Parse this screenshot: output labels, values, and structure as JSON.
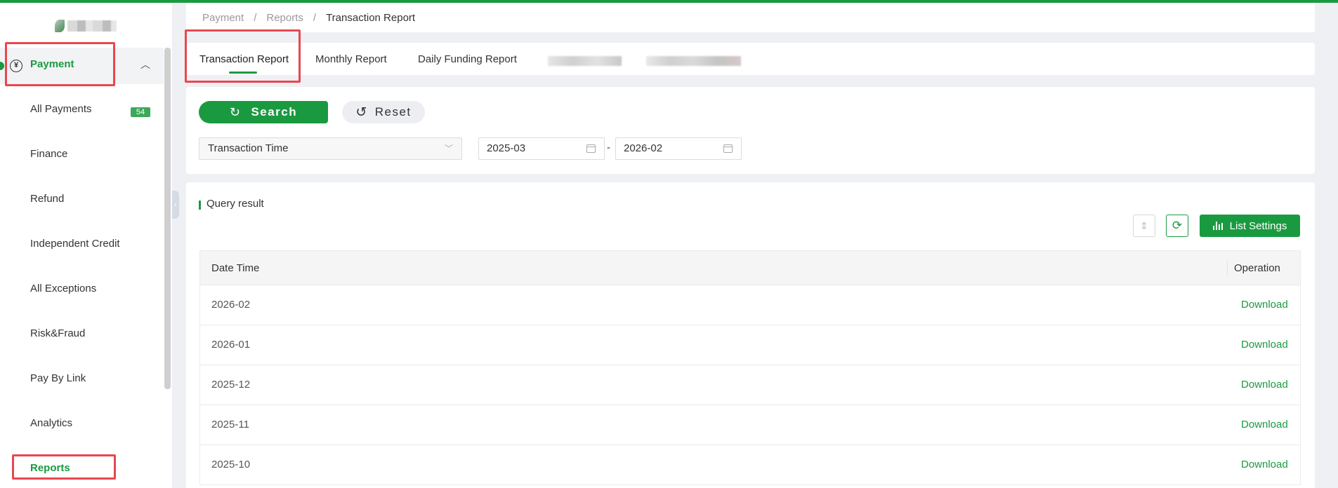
{
  "breadcrumb": {
    "items": [
      "Payment",
      "Reports"
    ],
    "current": "Transaction Report"
  },
  "sidebar": {
    "parent_label": "Payment",
    "payments_badge": "54",
    "items": [
      {
        "label": "All Payments"
      },
      {
        "label": "Finance"
      },
      {
        "label": "Refund"
      },
      {
        "label": "Independent Credit"
      },
      {
        "label": "All Exceptions"
      },
      {
        "label": "Risk&Fraud"
      },
      {
        "label": "Pay By Link"
      },
      {
        "label": "Analytics"
      },
      {
        "label": "Reports"
      }
    ]
  },
  "tabs": [
    {
      "label": "Transaction Report"
    },
    {
      "label": "Monthly Report"
    },
    {
      "label": "Daily Funding Report"
    }
  ],
  "search": {
    "search_label": "Search",
    "reset_label": "Reset",
    "time_type": "Transaction Time",
    "date_from": "2025-03",
    "date_to": "2026-02",
    "range_separator": "-"
  },
  "results": {
    "title": "Query result",
    "list_settings_label": "List Settings",
    "columns": {
      "date": "Date Time",
      "operation": "Operation"
    },
    "rows": [
      {
        "date": "2026-02",
        "action": "Download"
      },
      {
        "date": "2026-01",
        "action": "Download"
      },
      {
        "date": "2025-12",
        "action": "Download"
      },
      {
        "date": "2025-11",
        "action": "Download"
      },
      {
        "date": "2025-10",
        "action": "Download"
      }
    ]
  },
  "colors": {
    "primary": "#1a9a40",
    "highlight": "#e8474f",
    "background": "#eef0f3"
  }
}
